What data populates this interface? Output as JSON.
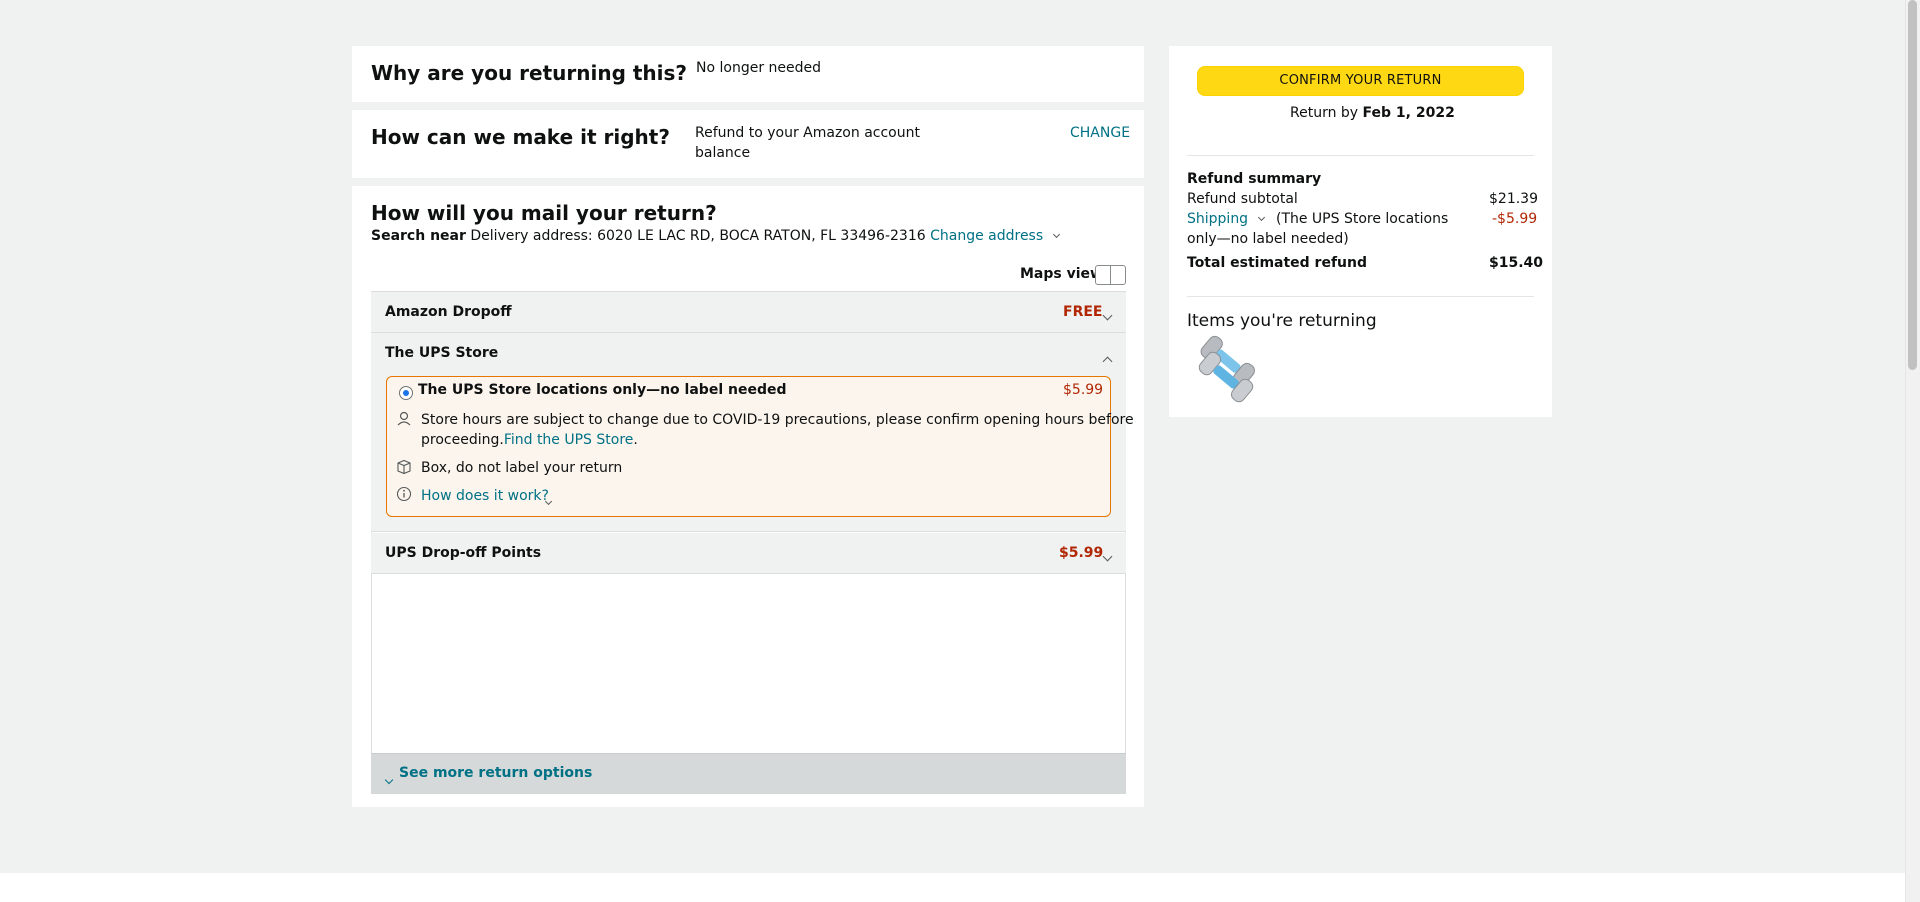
{
  "reason": {
    "heading": "Why are you returning this?",
    "value": "No longer needed"
  },
  "resolution": {
    "heading": "How can we make it right?",
    "value_line1": "Refund to your Amazon account",
    "value_line2": "balance",
    "change_label": "CHANGE"
  },
  "mail": {
    "heading": "How will you mail your return?",
    "search_near_label": "Search near",
    "address": "Delivery address: 6020 LE LAC RD, BOCA RATON, FL 33496-2316",
    "change_address_label": "Change address",
    "maps_view_label": "Maps view"
  },
  "options": {
    "amazon_dropoff": {
      "label": "Amazon Dropoff",
      "price": "FREE"
    },
    "ups_store": {
      "label": "The UPS Store",
      "selected_option": {
        "label": "The UPS Store locations only—no label needed",
        "price": "$5.99",
        "hours_note_line1": "Store hours are subject to change due to COVID-19 precautions, please confirm opening hours before",
        "hours_note_line2": "proceeding.",
        "find_store_link": "Find the UPS Store",
        "find_store_suffix": ".",
        "box_note": "Box, do not label your return",
        "how_it_works_label": "How does it work?"
      }
    },
    "ups_dropoff": {
      "label": "UPS Drop-off Points",
      "price": "$5.99"
    },
    "see_more_label": "See more return options"
  },
  "sidebar": {
    "confirm_button": "CONFIRM YOUR RETURN",
    "return_by_prefix": "Return by",
    "return_by_date": "Feb 1, 2022",
    "refund_summary": {
      "heading": "Refund summary",
      "subtotal_label": "Refund subtotal",
      "subtotal_value": "$21.39",
      "shipping_label": "Shipping",
      "shipping_note_line1": "(The UPS Store locations",
      "shipping_note_line2": "only—no label needed)",
      "shipping_value": "-$5.99",
      "total_label": "Total estimated refund",
      "total_value": "$15.40"
    },
    "items_heading": "Items you're returning",
    "item_image_icon": "dumbbells-image"
  },
  "colors": {
    "accent_link": "#007185",
    "price_red": "#b12704",
    "button_yellow": "#ffd814",
    "selected_border": "#e77600"
  }
}
